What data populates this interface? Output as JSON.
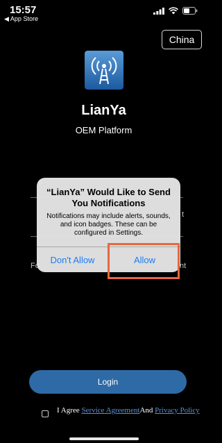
{
  "status_bar": {
    "time": "15:57",
    "back_label": "◀ App Store"
  },
  "header": {
    "region_button": "China"
  },
  "app": {
    "name": "LianYa",
    "subtitle": "OEM Platform"
  },
  "background_peeks": {
    "left_f": "F",
    "left_fo": "Fo",
    "right_t": "t",
    "right_nt": "nt"
  },
  "alert": {
    "title": "“LianYa” Would Like to Send You Notifications",
    "message": "Notifications may include alerts, sounds, and icon badges. These can be configured in Settings.",
    "deny_label": "Don't Allow",
    "allow_label": "Allow",
    "button_color": "#1a7cf2"
  },
  "login": {
    "label": "Login",
    "color": "#2e6aa6"
  },
  "agreement": {
    "prefix": "I Agree ",
    "service_link": "Service Agreement",
    "and_text": "And ",
    "privacy_link": "Privacy Policy"
  },
  "colors": {
    "background": "#000000",
    "highlight": "#e8673f"
  },
  "icons": [
    "signal-bars-icon",
    "wifi-icon",
    "battery-icon",
    "broadcast-tower-icon"
  ]
}
